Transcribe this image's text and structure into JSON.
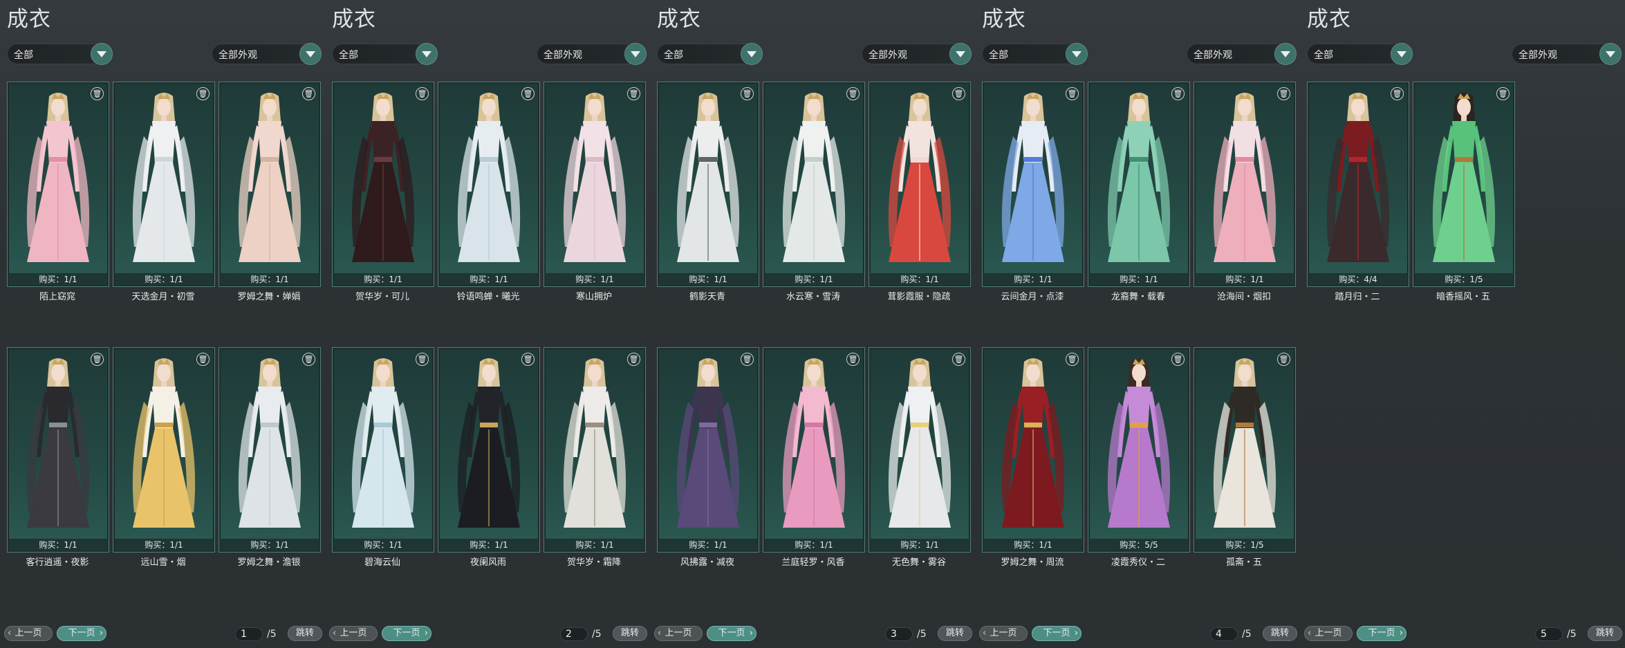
{
  "colors": {
    "background": "#2d3236",
    "card": "#244843",
    "accent": "#4d8f84",
    "dropdown_button": "#3e726a"
  },
  "panels": [
    {
      "title": "成衣",
      "filter_category": "全部",
      "filter_appearance": "全部外观",
      "items": [
        {
          "name": "陌上窈窕",
          "buy": "购买：1/1",
          "hair": "#d8c49a",
          "top": "#f3c6cf",
          "skirt": "#f0b5c2",
          "accent": "#e58fa3"
        },
        {
          "name": "天选金月・初雪",
          "buy": "购买：1/1",
          "hair": "#d8c49a",
          "top": "#eef0f2",
          "skirt": "#e4e8ea",
          "accent": "#cfd6da"
        },
        {
          "name": "罗姆之舞・婵娟",
          "buy": "购买：1/1",
          "hair": "#d8c49a",
          "top": "#f1d8cf",
          "skirt": "#ecd1c4",
          "accent": "#d6b2a2"
        },
        {
          "name": "客行逍遥・夜影",
          "buy": "购买：1/1",
          "hair": "#d8c49a",
          "top": "#2a2a2e",
          "skirt": "#3a3a40",
          "accent": "#8a8f96"
        },
        {
          "name": "远山雪・烟",
          "buy": "购买：1/1",
          "hair": "#d8c49a",
          "top": "#f4f0e6",
          "skirt": "#e9c36a",
          "accent": "#cfa04a"
        },
        {
          "name": "罗姆之舞・澹银",
          "buy": "购买：1/1",
          "hair": "#d8c49a",
          "top": "#e8ecef",
          "skirt": "#dde3e7",
          "accent": "#bfc8ce"
        }
      ],
      "pagination": {
        "prev": "上一页",
        "next": "下一页",
        "page": "1",
        "total": "/5",
        "jump": "跳转"
      }
    },
    {
      "title": "成衣",
      "filter_category": "全部",
      "filter_appearance": "全部外观",
      "items": [
        {
          "name": "贺华岁・可儿",
          "buy": "购买：1/1",
          "hair": "#d8c49a",
          "top": "#3b2325",
          "skirt": "#2f1a1c",
          "accent": "#6b3a3d"
        },
        {
          "name": "铃语鸣蝉・曦光",
          "buy": "购买：1/1",
          "hair": "#d8c49a",
          "top": "#e6edf1",
          "skirt": "#d9e4ea",
          "accent": "#b8cbd4"
        },
        {
          "name": "寒山拥炉",
          "buy": "购买：1/1",
          "hair": "#d8c49a",
          "top": "#f2e1e6",
          "skirt": "#ecd6de",
          "accent": "#dcb9c6"
        },
        {
          "name": "碧海云仙",
          "buy": "购买：1/1",
          "hair": "#d8c49a",
          "top": "#e1ecf0",
          "skirt": "#d5e6ec",
          "accent": "#a9c9d4"
        },
        {
          "name": "夜阑风雨",
          "buy": "购买：1/1",
          "hair": "#d8c49a",
          "top": "#22242a",
          "skirt": "#1b1d22",
          "accent": "#c9a45a"
        },
        {
          "name": "贺华岁・霜降",
          "buy": "购买：1/1",
          "hair": "#d8c49a",
          "top": "#ecebe7",
          "skirt": "#e2e0da",
          "accent": "#9a8f80"
        }
      ],
      "pagination": {
        "prev": "上一页",
        "next": "下一页",
        "page": "2",
        "total": "/5",
        "jump": "跳转"
      }
    },
    {
      "title": "成衣",
      "filter_category": "全部",
      "filter_appearance": "全部外观",
      "items": [
        {
          "name": "鹤影天青",
          "buy": "购买：1/1",
          "hair": "#d8c49a",
          "top": "#eceeee",
          "skirt": "#e3e6e6",
          "accent": "#5d6668"
        },
        {
          "name": "水云寒・雪涛",
          "buy": "购买：1/1",
          "hair": "#d8c49a",
          "top": "#eef1f0",
          "skirt": "#e4e9e7",
          "accent": "#c3cfcb"
        },
        {
          "name": "茸影霞服・隐疏",
          "buy": "购买：1/1",
          "hair": "#d8c49a",
          "top": "#f3e3de",
          "skirt": "#d9483e",
          "accent": "#f0d9d3"
        },
        {
          "name": "风拂露・减夜",
          "buy": "购买：1/1",
          "hair": "#d8c49a",
          "top": "#3d3450",
          "skirt": "#5a4a7a",
          "accent": "#7e6a9e"
        },
        {
          "name": "兰庭轻罗・风香",
          "buy": "购买：1/1",
          "hair": "#d8c49a",
          "top": "#f2b9cf",
          "skirt": "#e99bbf",
          "accent": "#d478a4"
        },
        {
          "name": "无色舞・雾谷",
          "buy": "购买：1/1",
          "hair": "#d8c49a",
          "top": "#eef0f1",
          "skirt": "#e6e8ea",
          "accent": "#e9cf7a"
        }
      ],
      "pagination": {
        "prev": "上一页",
        "next": "下一页",
        "page": "3",
        "total": "/5",
        "jump": "跳转"
      }
    },
    {
      "title": "成衣",
      "filter_category": "全部",
      "filter_appearance": "全部外观",
      "items": [
        {
          "name": "云间金月・点漆",
          "buy": "购买：1/1",
          "hair": "#d8c49a",
          "top": "#e6ecf4",
          "skirt": "#7fa8e6",
          "accent": "#4d7fd8"
        },
        {
          "name": "龙裔舞・载春",
          "buy": "购买：1/1",
          "hair": "#d8c49a",
          "top": "#8ed1b6",
          "skirt": "#7cc6aa",
          "accent": "#3f8f77"
        },
        {
          "name": "沧海间・烟扣",
          "buy": "购买：1/1",
          "hair": "#d8c49a",
          "top": "#f2dfe4",
          "skirt": "#eeaebb",
          "accent": "#e58a9c"
        },
        {
          "name": "罗姆之舞・周流",
          "buy": "购买：1/1",
          "hair": "#d8c49a",
          "top": "#9a1f24",
          "skirt": "#7d1a1f",
          "accent": "#d9b25a"
        },
        {
          "name": "凌霞秀仪・二",
          "buy": "购买：5/5",
          "hair": "#3a2b25",
          "top": "#c58ad8",
          "skirt": "#b679cc",
          "accent": "#e0a04a"
        },
        {
          "name": "孤斋・五",
          "buy": "购买：1/5",
          "hair": "#d8c49a",
          "top": "#2e2a26",
          "skirt": "#e9e4dc",
          "accent": "#b07a3a"
        }
      ],
      "pagination": {
        "prev": "上一页",
        "next": "下一页",
        "page": "4",
        "total": "/5",
        "jump": "跳转"
      }
    },
    {
      "title": "成衣",
      "filter_category": "全部",
      "filter_appearance": "全部外观",
      "items": [
        {
          "name": "踏月归・二",
          "buy": "购买：4/4",
          "hair": "#d8c49a",
          "top": "#7a1c20",
          "skirt": "#3a2a2c",
          "accent": "#b2262c"
        },
        {
          "name": "暗香摇风・五",
          "buy": "购买：1/5",
          "hair": "#2b2420",
          "top": "#58c27a",
          "skirt": "#6fd08e",
          "accent": "#b0783a"
        }
      ],
      "pagination": {
        "prev": "上一页",
        "next": "下一页",
        "page": "5",
        "total": "/5",
        "jump": "跳转"
      }
    }
  ]
}
